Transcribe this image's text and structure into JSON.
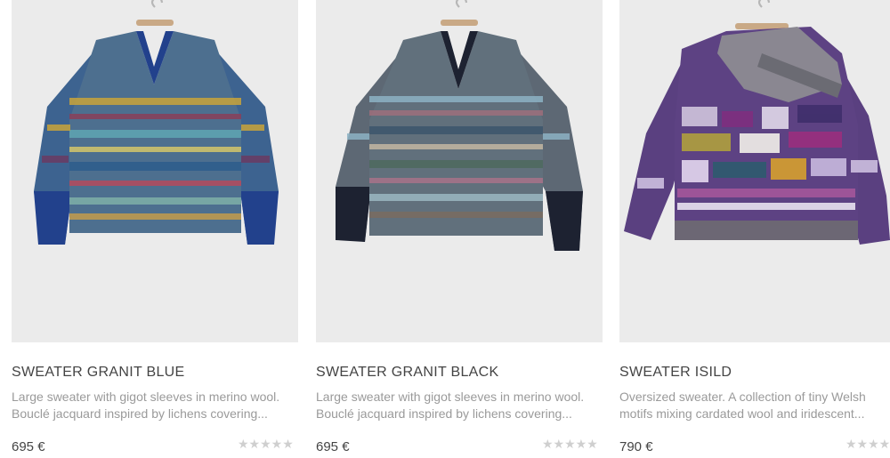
{
  "products": [
    {
      "title": "SWEATER GRANIT BLUE",
      "desc_line1": "Large sweater with gigot sleeves in merino wool.",
      "desc_line2": "Bouclé jacquard inspired by lichens covering...",
      "price": "695 €",
      "rating_stars": "★★★★★",
      "rating_value": 0,
      "colors": {
        "body": "#3c5b8a",
        "cuff": "#23408a",
        "accent": "#d7b648"
      }
    },
    {
      "title": "SWEATER GRANIT BLACK",
      "desc_line1": "Large sweater with gigot sleeves in merino wool.",
      "desc_line2": "Bouclé jacquard inspired by lichens covering...",
      "price": "695 €",
      "rating_stars": "★★★★★",
      "rating_value": 0,
      "colors": {
        "body": "#56626f",
        "cuff": "#1d2230",
        "accent": "#8fb3c8"
      }
    },
    {
      "title": "SWEATER ISILD",
      "desc_line1": "Oversized sweater. A collection of tiny Welsh",
      "desc_line2": "motifs mixing cardated wool and iridescent...",
      "price": "790 €",
      "rating_stars": "★★★★★",
      "rating_value": 0,
      "colors": {
        "body": "#5b3f82",
        "cuff": "#6b6b6b",
        "accent": "#c9c2d9"
      }
    }
  ]
}
